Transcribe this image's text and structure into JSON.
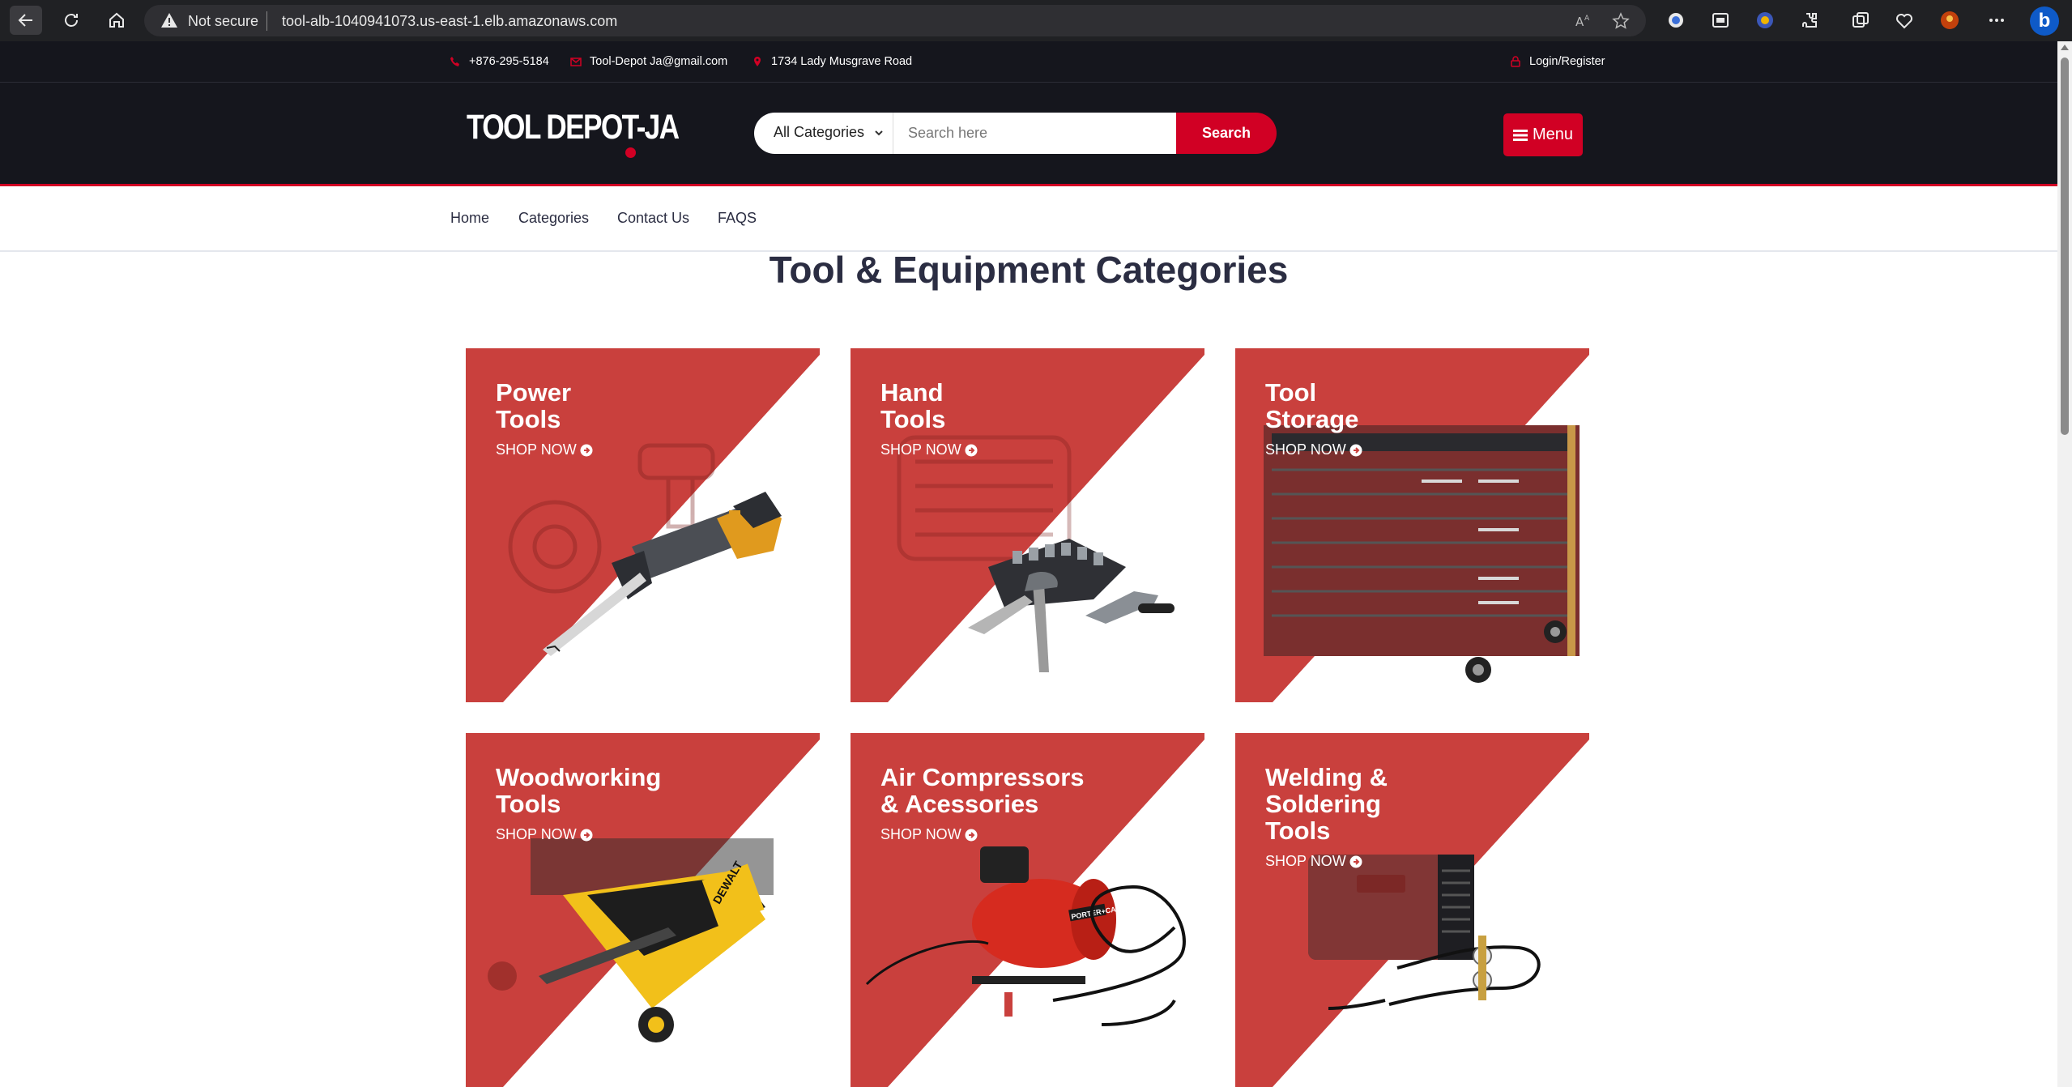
{
  "browser": {
    "security_label": "Not secure",
    "url": "tool-alb-1040941073.us-east-1.elb.amazonaws.com",
    "icons": [
      "back-icon",
      "reload-icon",
      "home-icon",
      "warning-icon",
      "read-aloud-icon",
      "favorite-star-icon",
      "bing-icon"
    ]
  },
  "topbar": {
    "phone": "+876-295-5184",
    "email": "Tool-Depot Ja@gmail.com",
    "address": "1734 Lady Musgrave Road",
    "login": "Login/Register"
  },
  "header": {
    "logo": "TOOL DEPOT-JA",
    "category_select": "All Categories",
    "search_placeholder": "Search here",
    "search_button": "Search",
    "menu_button": "Menu"
  },
  "nav": {
    "items": [
      "Home",
      "Categories",
      "Contact Us",
      "FAQS"
    ]
  },
  "main": {
    "title": "Tool & Equipment Categories",
    "categories": [
      {
        "title": "Power\nTools",
        "cta": "SHOP NOW"
      },
      {
        "title": "Hand\nTools",
        "cta": "SHOP NOW"
      },
      {
        "title": "Tool\nStorage",
        "cta": "SHOP NOW"
      },
      {
        "title": "Woodworking\nTools",
        "cta": "SHOP NOW"
      },
      {
        "title": "Air Compressors\n& Acessories",
        "cta": "SHOP NOW"
      },
      {
        "title": "Welding &\nSoldering\nTools",
        "cta": "SHOP NOW"
      }
    ]
  },
  "colors": {
    "brand_red": "#d10024",
    "card_red": "#c9403d",
    "header_bg": "#15161d",
    "title_text": "#2b2d42"
  }
}
